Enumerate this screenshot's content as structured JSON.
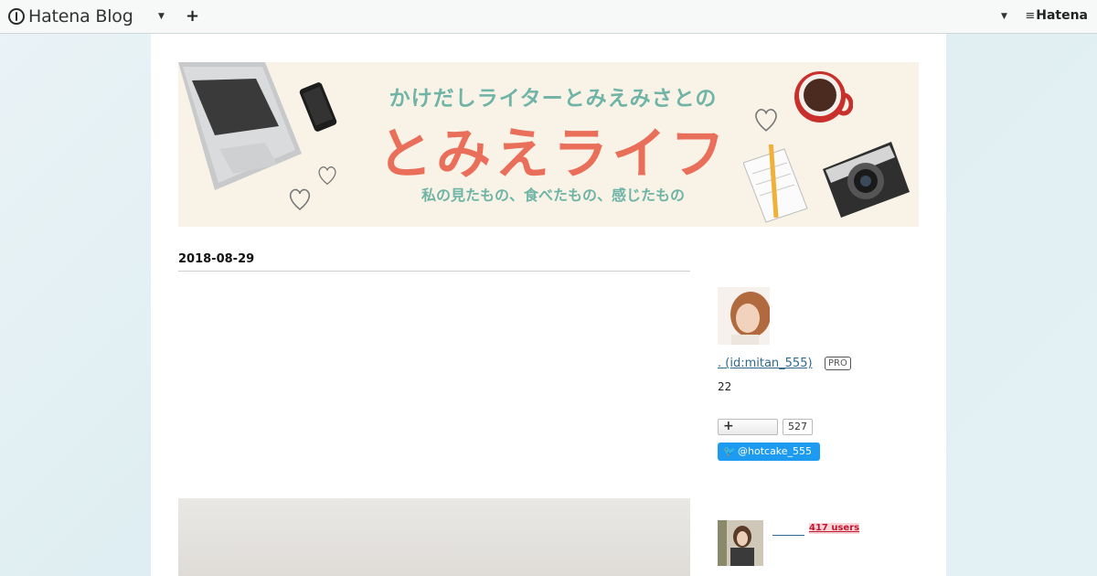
{
  "globalbar": {
    "brand": "Hatena Blog",
    "add_label": "+",
    "right_brand": "Hatena"
  },
  "banner": {
    "line1": "かけだしライターとみえみさとの",
    "line2": "とみえライフ",
    "line3": "私の見たもの、食べたもの、感じたもの"
  },
  "entry": {
    "date": "2018-08-29"
  },
  "sidebar": {
    "profile_name": ". (id:mitan_555)",
    "pro_badge": "PRO",
    "count": "22",
    "follow_label": "+",
    "follower_count": "527",
    "twitter_label": "@hotcake_555",
    "users_badge": "417 users"
  },
  "colors": {
    "banner_teal": "#6fb4a7",
    "banner_coral": "#ea6f5a",
    "link": "#2e6a8f",
    "twitter": "#1d9bf0"
  },
  "icons": [
    "hatena-blog-logo-icon",
    "chevron-down-icon",
    "plus-icon",
    "hatena-logo-icon",
    "twitter-bird-icon"
  ]
}
